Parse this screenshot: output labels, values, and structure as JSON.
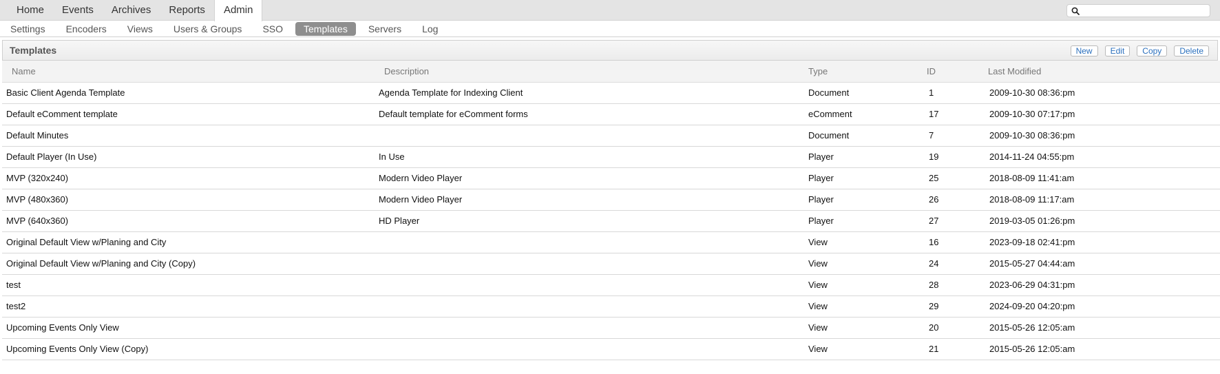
{
  "topnav": {
    "tabs": [
      {
        "label": "Home"
      },
      {
        "label": "Events"
      },
      {
        "label": "Archives"
      },
      {
        "label": "Reports"
      },
      {
        "label": "Admin"
      }
    ],
    "active_tab": "Admin",
    "search": {
      "value": "",
      "placeholder": "",
      "icon": "search-icon"
    }
  },
  "subnav": {
    "items": [
      {
        "label": "Settings"
      },
      {
        "label": "Encoders"
      },
      {
        "label": "Views"
      },
      {
        "label": "Users & Groups"
      },
      {
        "label": "SSO"
      },
      {
        "label": "Templates"
      },
      {
        "label": "Servers"
      },
      {
        "label": "Log"
      }
    ],
    "active_item": "Templates"
  },
  "panel": {
    "title": "Templates",
    "actions": {
      "new": "New",
      "edit": "Edit",
      "copy": "Copy",
      "delete": "Delete"
    }
  },
  "table": {
    "headers": {
      "name": "Name",
      "description": "Description",
      "type": "Type",
      "id": "ID",
      "modified": "Last Modified"
    },
    "rows": [
      {
        "name": "Basic Client Agenda Template",
        "description": "Agenda Template for Indexing Client",
        "type": "Document",
        "id": "1",
        "modified": "2009-10-30 08:36:pm"
      },
      {
        "name": "Default eComment template",
        "description": "Default template for eComment forms",
        "type": "eComment",
        "id": "17",
        "modified": "2009-10-30 07:17:pm"
      },
      {
        "name": "Default Minutes",
        "description": "",
        "type": "Document",
        "id": "7",
        "modified": "2009-10-30 08:36:pm"
      },
      {
        "name": "Default Player (In Use)",
        "description": "In Use",
        "type": "Player",
        "id": "19",
        "modified": "2014-11-24 04:55:pm"
      },
      {
        "name": "MVP (320x240)",
        "description": "Modern Video Player",
        "type": "Player",
        "id": "25",
        "modified": "2018-08-09 11:41:am"
      },
      {
        "name": "MVP (480x360)",
        "description": "Modern Video Player",
        "type": "Player",
        "id": "26",
        "modified": "2018-08-09 11:17:am"
      },
      {
        "name": "MVP (640x360)",
        "description": "HD Player",
        "type": "Player",
        "id": "27",
        "modified": "2019-03-05 01:26:pm"
      },
      {
        "name": "Original Default View w/Planing and City",
        "description": "",
        "type": "View",
        "id": "16",
        "modified": "2023-09-18 02:41:pm"
      },
      {
        "name": "Original Default View w/Planing and City (Copy)",
        "description": "",
        "type": "View",
        "id": "24",
        "modified": "2015-05-27 04:44:am"
      },
      {
        "name": "test",
        "description": "",
        "type": "View",
        "id": "28",
        "modified": "2023-06-29 04:31:pm"
      },
      {
        "name": "test2",
        "description": "",
        "type": "View",
        "id": "29",
        "modified": "2024-09-20 04:20:pm"
      },
      {
        "name": "Upcoming Events Only View",
        "description": "",
        "type": "View",
        "id": "20",
        "modified": "2015-05-26 12:05:am"
      },
      {
        "name": "Upcoming Events Only View (Copy)",
        "description": "",
        "type": "View",
        "id": "21",
        "modified": "2015-05-26 12:05:am"
      }
    ]
  },
  "colors": {
    "active_subnav_bg": "#8e8e8e",
    "action_button_text": "#2a6fbd",
    "topnav_bg": "#e4e4e4"
  }
}
